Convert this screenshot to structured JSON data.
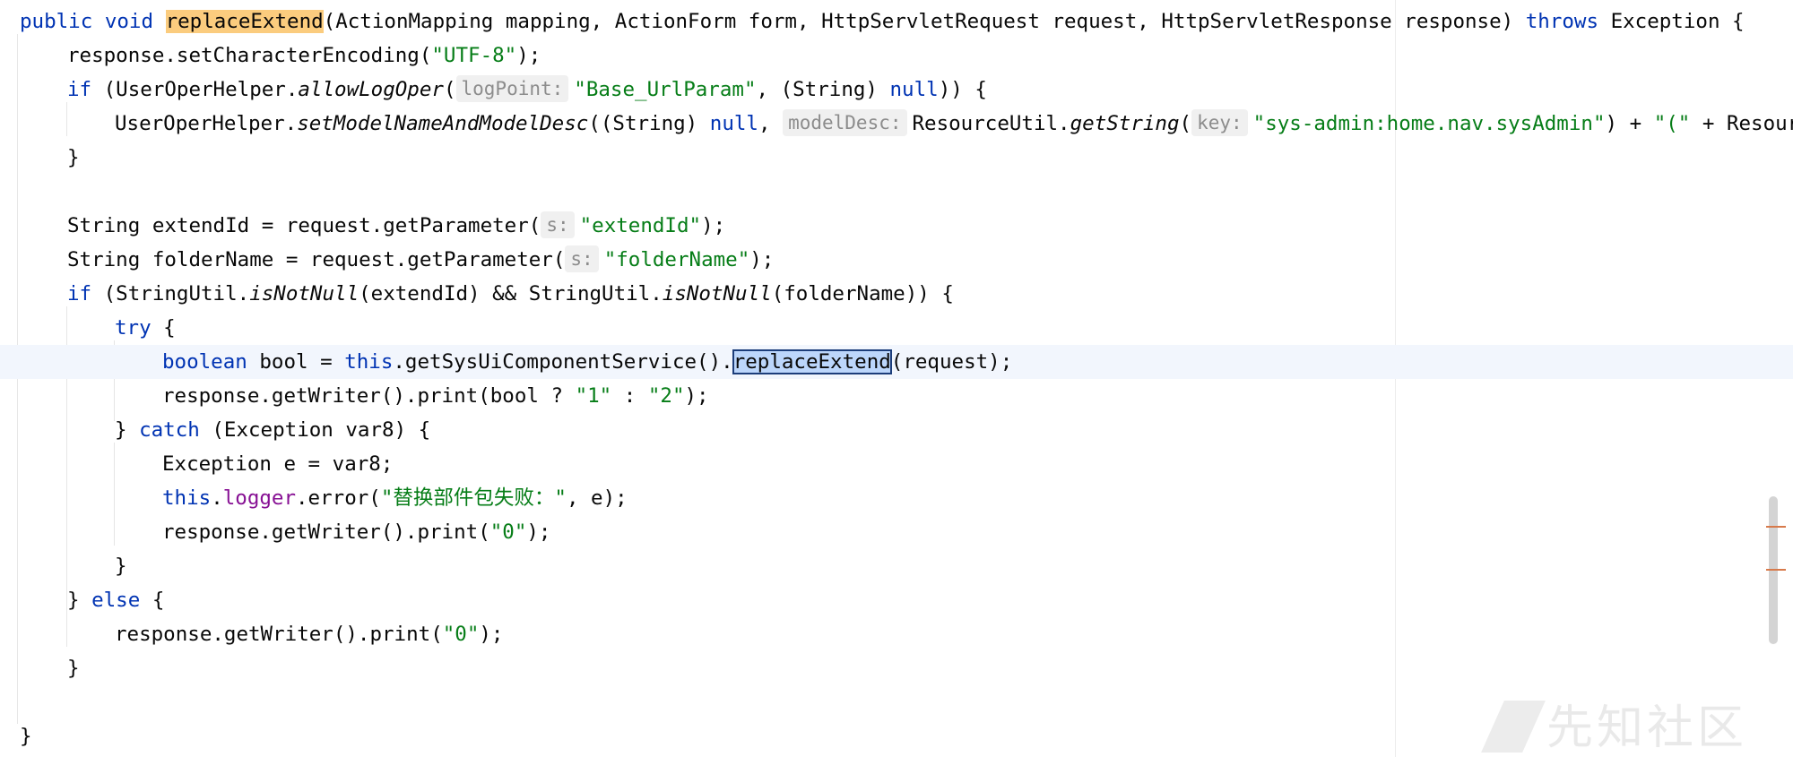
{
  "code": {
    "l0": {
      "t1": "public",
      "t2": "void",
      "t3": "replaceExtend",
      "t4": "(ActionMapping mapping, ActionForm form, HttpServletRequest request, HttpServletResponse response) ",
      "t5": "throws",
      "t6": " Exception {"
    },
    "l1": {
      "t1": "response.setCharacterEncoding(",
      "t2": "\"UTF-8\"",
      "t3": ");"
    },
    "l2": {
      "t1": "if",
      "t2": " (UserOperHelper.",
      "t3": "allowLogOper",
      "t4": "(",
      "hint": "logPoint:",
      "t5": "\"Base_UrlParam\"",
      "t6": ", (String) ",
      "t7": "null",
      "t8": ")) {"
    },
    "l3": {
      "t1": "UserOperHelper.",
      "t2": "setModelNameAndModelDesc",
      "t3": "((String) ",
      "t4": "null",
      "t5": ", ",
      "hint1": "modelDesc:",
      "t6": "ResourceUtil.",
      "t7": "getString",
      "t8": "(",
      "hint2": "key:",
      "t9": "\"sys-admin:home.nav.sysAdmin\"",
      "t10": ") + ",
      "t11": "\"(\"",
      "t12": " + Resource"
    },
    "l4": {
      "t1": "}"
    },
    "l6": {
      "t1": "String extendId = request.getParameter(",
      "hint": "s:",
      "t2": "\"extendId\"",
      "t3": ");"
    },
    "l7": {
      "t1": "String folderName = request.getParameter(",
      "hint": "s:",
      "t2": "\"folderName\"",
      "t3": ");"
    },
    "l8": {
      "t1": "if",
      "t2": " (StringUtil.",
      "t3": "isNotNull",
      "t4": "(extendId) && StringUtil.",
      "t5": "isNotNull",
      "t6": "(folderName)) {"
    },
    "l9": {
      "t1": "try",
      "t2": " {"
    },
    "l10": {
      "t1": "boolean",
      "t2": " bool = ",
      "t3": "this",
      "t4": ".getSysUiComponentService().",
      "t5": "replaceExtend",
      "t6": "(request);"
    },
    "l11": {
      "t1": "response.getWriter().print(bool ? ",
      "t2": "\"1\"",
      "t3": " : ",
      "t4": "\"2\"",
      "t5": ");"
    },
    "l12": {
      "t1": "} ",
      "t2": "catch",
      "t3": " (Exception var8) {"
    },
    "l13": {
      "t1": "Exception e = var8;"
    },
    "l14": {
      "t1": "this",
      "t2": ".",
      "t3": "logger",
      "t4": ".error(",
      "t5": "\"替换部件包失败：\"",
      "t6": ", e);"
    },
    "l15": {
      "t1": "response.getWriter().print(",
      "t2": "\"0\"",
      "t3": ");"
    },
    "l16": {
      "t1": "}"
    },
    "l17": {
      "t1": "} ",
      "t2": "else",
      "t3": " {"
    },
    "l18": {
      "t1": "response.getWriter().print(",
      "t2": "\"0\"",
      "t3": ");"
    },
    "l19": {
      "t1": "}"
    },
    "l21": {
      "t1": "}"
    }
  },
  "watermark": "先知社区",
  "colors": {
    "keyword": "#0033b3",
    "string": "#067d17",
    "field": "#871094",
    "usage_highlight": "#fbcc7e",
    "selection": "#bcd6fb",
    "current_line": "#f2f6fd"
  }
}
